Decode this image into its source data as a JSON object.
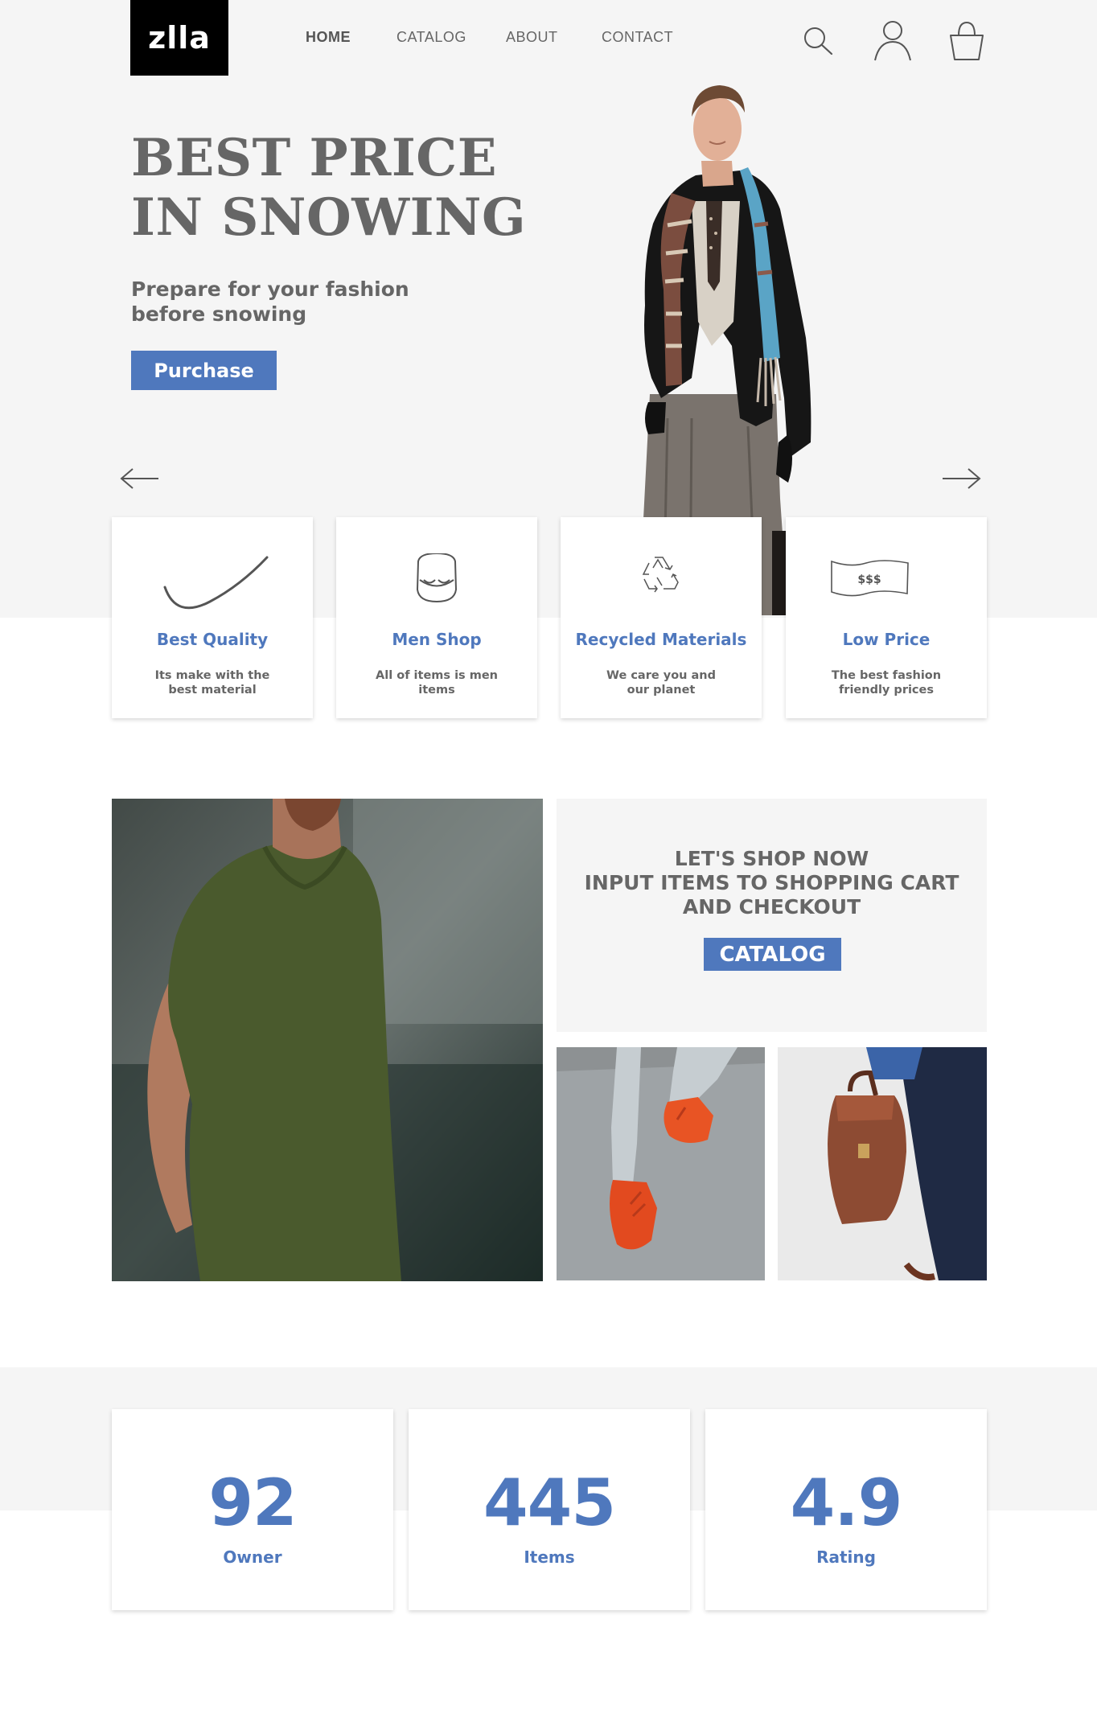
{
  "brand": {
    "logo": "zlla"
  },
  "nav": [
    {
      "label": "HOME",
      "active": true
    },
    {
      "label": "CATALOG",
      "active": false
    },
    {
      "label": "ABOUT",
      "active": false
    },
    {
      "label": "CONTACT",
      "active": false
    }
  ],
  "header_icons": [
    "search-icon",
    "user-icon",
    "shopping-bag-icon"
  ],
  "hero": {
    "title_line1": "BEST PRICE",
    "title_line2": "IN SNOWING",
    "subtitle": "Prepare for your fashion before snowing",
    "button": "Purchase",
    "prev_icon": "arrow-left-icon",
    "next_icon": "arrow-right-icon"
  },
  "features": [
    {
      "icon": "check-swoosh-icon",
      "title": "Best Quality",
      "desc": "Its make with the best material"
    },
    {
      "icon": "smile-face-icon",
      "title": "Men Shop",
      "desc": "All of items is men items"
    },
    {
      "icon": "recycle-icon",
      "title": "Recycled Materials",
      "desc": "We care you and our planet"
    },
    {
      "icon": "banknote-icon",
      "title": "Low Price",
      "desc": "The best fashion friendly prices",
      "banknote_text": "$$$"
    }
  ],
  "promo": {
    "line1": "LET'S SHOP NOW",
    "line2": "INPUT ITEMS TO SHOPPING CART",
    "line3": "AND CHECKOUT",
    "button": "CATALOG"
  },
  "stats": [
    {
      "value": "92",
      "label": "Owner"
    },
    {
      "value": "445",
      "label": "Items"
    },
    {
      "value": "4.9",
      "label": "Rating"
    }
  ],
  "colors": {
    "accent": "#4f78bd",
    "text_gray": "#666666",
    "light_bg": "#f5f5f5",
    "logo_bg": "#000000"
  }
}
